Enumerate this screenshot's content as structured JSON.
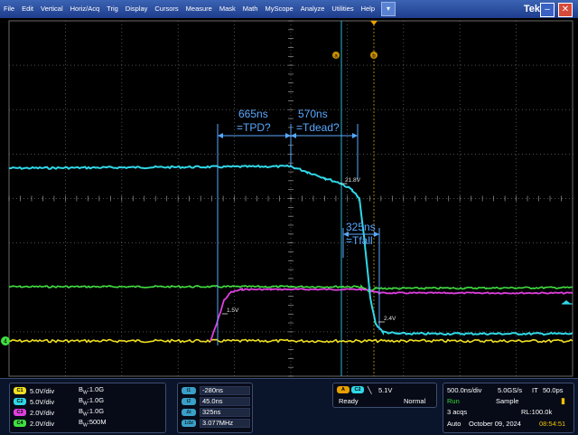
{
  "menu": {
    "items": [
      "File",
      "Edit",
      "Vertical",
      "Horiz/Acq",
      "Trig",
      "Display",
      "Cursors",
      "Measure",
      "Mask",
      "Math",
      "MyScope",
      "Analyze",
      "Utilities",
      "Help"
    ],
    "dropdown_glyph": "▾",
    "brand": "Tek",
    "minimize_glyph": "–",
    "close_glyph": "✕"
  },
  "cursor_labels": {
    "a": "a",
    "b": "b"
  },
  "channel_marker": "4",
  "annotations": {
    "tpd_value": "665ns",
    "tpd_label": "=TPD?",
    "tdead_value": "570ns",
    "tdead_label": "=Tdead?",
    "tfall_value": "325ns",
    "tfall_label": "=Tfall"
  },
  "point_labels": {
    "v21": "21.8V",
    "v15": "1.5V",
    "v24": "2.4V"
  },
  "channels": [
    {
      "tag": "C1",
      "scale": "5.0V/div",
      "bw": "1.0G",
      "color": "#f0e020"
    },
    {
      "tag": "C2",
      "scale": "5.0V/div",
      "bw": "1.0G",
      "color": "#30d8e8"
    },
    {
      "tag": "C3",
      "scale": "2.0V/div",
      "bw": "1.0G",
      "color": "#e040e0"
    },
    {
      "tag": "C4",
      "scale": "2.0V/div",
      "bw": "500M",
      "color": "#40e040"
    }
  ],
  "bw_prefix": "B",
  "bw_sub": "W",
  "measurements": [
    {
      "tag": "t1",
      "value": "-280ns"
    },
    {
      "tag": "t2",
      "value": "45.0ns"
    },
    {
      "tag": "Δt",
      "value": "325ns"
    },
    {
      "tag": "1/Δt",
      "value": "3.077MHz"
    }
  ],
  "trigger": {
    "mode_tag": "A",
    "source_tag": "C2",
    "slope_glyph": "╲",
    "level": "5.1V",
    "state": "Ready",
    "coupling": "Normal"
  },
  "acquisition": {
    "timebase": "500.0ns/div",
    "sample_rate": "5.0GS/s",
    "it_label": "IT",
    "it_value": "50.0ps",
    "run_state": "Run",
    "mode": "Sample",
    "acqs": "3 acqs",
    "record_length": "RL:100.0k",
    "trigger_mode": "Auto",
    "date": "October 09, 2024",
    "time": "08:54:51"
  },
  "colors": {
    "ch1": "#f0e020",
    "ch2": "#30d8e8",
    "ch3": "#e040e0",
    "ch4": "#40e040",
    "annotation": "#58a8ff",
    "cursor": "#2ab8d0"
  }
}
